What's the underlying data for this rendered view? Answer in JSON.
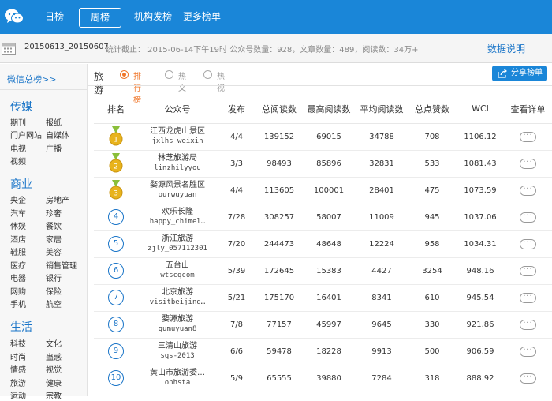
{
  "nav": {
    "items": [
      {
        "label": "日榜"
      },
      {
        "label": "周榜"
      },
      {
        "label": "机构发榜"
      },
      {
        "label": "更多榜单"
      }
    ]
  },
  "info": {
    "date_range": "20150613_20150607",
    "stats": "统计截止： 2015-06-14下午19时 公众号数量：928，文章数量：489，阅读数：34万+",
    "explain_label": "数据说明"
  },
  "sidebar": {
    "link": "微信总榜>>",
    "categories": [
      {
        "title": "传媒",
        "items": [
          "期刊",
          "报纸",
          "门户网站",
          "自媒体",
          "电视",
          "广播",
          "视频"
        ]
      },
      {
        "title": "商业",
        "items": [
          "央企",
          "房地产",
          "汽车",
          "珍奢",
          "休娱",
          "餐饮",
          "酒店",
          "家居",
          "鞋服",
          "美容",
          "医疗",
          "销售管理",
          "电器",
          "银行",
          "网购",
          "保险",
          "手机",
          "航空"
        ]
      },
      {
        "title": "生活",
        "items": [
          "科技",
          "文化",
          "时尚",
          "蛊惑",
          "情感",
          "视觉",
          "旅游",
          "健康",
          "运动",
          "宗教"
        ]
      }
    ]
  },
  "filter": {
    "category": "旅游",
    "options": [
      "排行榜",
      "热文",
      "热视"
    ],
    "selected": "排行榜",
    "share_label": "分享榜单"
  },
  "table": {
    "headers": [
      "排名",
      "公众号",
      "发布",
      "总阅读数",
      "最高阅读数",
      "平均阅读数",
      "总点赞数",
      "WCI",
      "查看详单"
    ],
    "rows": [
      {
        "rank": "1",
        "name": "江西龙虎山景区",
        "id": "jxlhs_weixin",
        "publish": "4/4",
        "total": "139152",
        "max": "69015",
        "avg": "34788",
        "likes": "708",
        "wci": "1106.12"
      },
      {
        "rank": "2",
        "name": "林芝旅游局",
        "id": "linzhilyyou",
        "publish": "3/3",
        "total": "98493",
        "max": "85896",
        "avg": "32831",
        "likes": "533",
        "wci": "1081.43"
      },
      {
        "rank": "3",
        "name": "婺源风景名胜区",
        "id": "ourwuyuan",
        "publish": "4/4",
        "total": "113605",
        "max": "100001",
        "avg": "28401",
        "likes": "475",
        "wci": "1073.59"
      },
      {
        "rank": "4",
        "name": "欢乐长隆",
        "id": "happy_chimel…",
        "publish": "7/28",
        "total": "308257",
        "max": "58007",
        "avg": "11009",
        "likes": "945",
        "wci": "1037.06"
      },
      {
        "rank": "5",
        "name": "浙江旅游",
        "id": "zjly_057112301",
        "publish": "7/20",
        "total": "244473",
        "max": "48648",
        "avg": "12224",
        "likes": "958",
        "wci": "1034.31"
      },
      {
        "rank": "6",
        "name": "五台山",
        "id": "wtscqcom",
        "publish": "5/39",
        "total": "172645",
        "max": "15383",
        "avg": "4427",
        "likes": "3254",
        "wci": "948.16"
      },
      {
        "rank": "7",
        "name": "北京旅游",
        "id": "visitbeijing…",
        "publish": "5/21",
        "total": "175170",
        "max": "16401",
        "avg": "8341",
        "likes": "610",
        "wci": "945.54"
      },
      {
        "rank": "8",
        "name": "婺源旅游",
        "id": "qumuyuan8",
        "publish": "7/8",
        "total": "77157",
        "max": "45997",
        "avg": "9645",
        "likes": "330",
        "wci": "921.86"
      },
      {
        "rank": "9",
        "name": "三清山旅游",
        "id": "sqs-2013",
        "publish": "6/6",
        "total": "59478",
        "max": "18228",
        "avg": "9913",
        "likes": "500",
        "wci": "906.59"
      },
      {
        "rank": "10",
        "name": "黄山市旅游委…",
        "id": "onhsta",
        "publish": "5/9",
        "total": "65555",
        "max": "39880",
        "avg": "7284",
        "likes": "318",
        "wci": "888.92"
      }
    ],
    "more_label": "···"
  },
  "colors": {
    "brand_blue": "#1a86d8",
    "medal_gold": "#e8b31c",
    "radio_orange": "#f0772b"
  }
}
